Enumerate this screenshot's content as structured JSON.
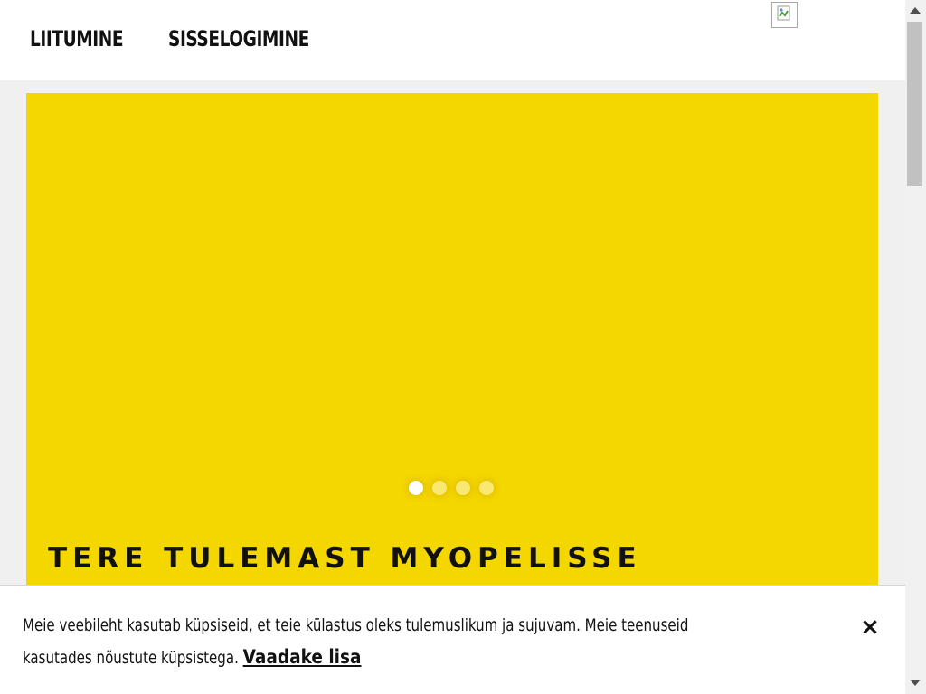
{
  "header": {
    "nav": [
      {
        "label": "LIITUMINE"
      },
      {
        "label": "SISSELOGIMINE"
      }
    ],
    "logo_icon": "broken-image-icon"
  },
  "hero": {
    "title": "TERE TULEMAST MYOPELISSE",
    "background_color": "#f5d700",
    "carousel": {
      "slide_count": 4,
      "active_index": 0
    }
  },
  "cookie_banner": {
    "line1": "Meie veebileht kasutab küpsiseid, et teie külastus oleks tulemuslikum ja sujuvam. Meie teenuseid",
    "line2": "kasutades nõustute küpsistega.",
    "link_label": "Vaadake lisa",
    "close_icon": "close-icon",
    "close_glyph": "×"
  },
  "scrollbar": {
    "position_fraction": 0.0
  }
}
